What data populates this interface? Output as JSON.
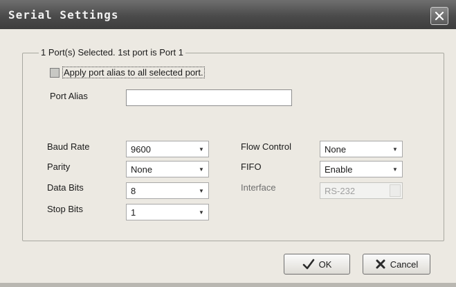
{
  "window": {
    "title": "Serial Settings",
    "close_icon": "close-x-icon"
  },
  "group": {
    "caption": "1 Port(s) Selected. 1st port is Port 1"
  },
  "apply_alias": {
    "label": "Apply port alias to all selected port.",
    "checked": false
  },
  "port_alias": {
    "label": "Port Alias",
    "value": ""
  },
  "fields": {
    "baud_rate": {
      "label": "Baud Rate",
      "value": "9600"
    },
    "parity": {
      "label": "Parity",
      "value": "None"
    },
    "data_bits": {
      "label": "Data Bits",
      "value": "8"
    },
    "stop_bits": {
      "label": "Stop Bits",
      "value": "1"
    },
    "flow_control": {
      "label": "Flow Control",
      "value": "None"
    },
    "fifo": {
      "label": "FIFO",
      "value": "Enable"
    },
    "interface": {
      "label": "Interface",
      "value": "RS-232",
      "disabled": true
    }
  },
  "buttons": {
    "ok": {
      "label": "OK",
      "icon": "checkmark-icon"
    },
    "cancel": {
      "label": "Cancel",
      "icon": "x-cross-icon"
    }
  }
}
